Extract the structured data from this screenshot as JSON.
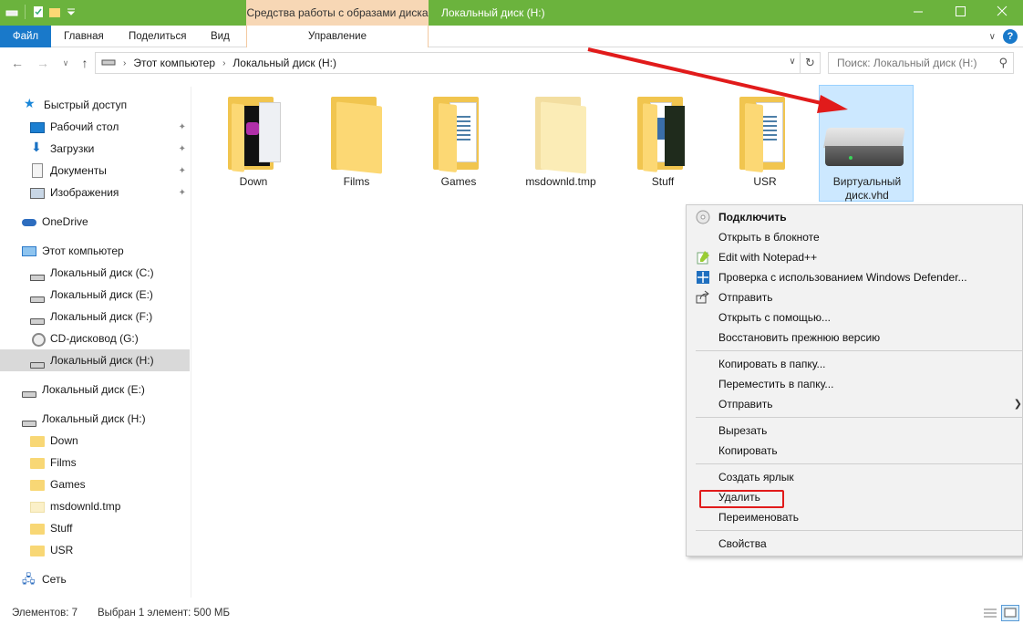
{
  "window": {
    "title": "Локальный диск (H:)",
    "context_tab_title": "Средства работы с образами диска",
    "minimize_icon": "minimize-icon",
    "maximize_icon": "maximize-icon",
    "close_icon": "close-icon"
  },
  "ribbon": {
    "tabs": {
      "file": "Файл",
      "home": "Главная",
      "share": "Поделиться",
      "view": "Вид",
      "manage": "Управление"
    }
  },
  "nav": {
    "breadcrumb": [
      "Этот компьютер",
      "Локальный диск (H:)"
    ],
    "search_placeholder": "Поиск: Локальный диск (H:)"
  },
  "sidebar": {
    "items": [
      {
        "label": "Быстрый доступ",
        "icon": "star-icon"
      },
      {
        "label": "Рабочий стол",
        "icon": "desktop-icon"
      },
      {
        "label": "Загрузки",
        "icon": "download-icon"
      },
      {
        "label": "Документы",
        "icon": "documents-icon"
      },
      {
        "label": "Изображения",
        "icon": "pictures-icon"
      },
      {
        "label": "OneDrive",
        "icon": "cloud-icon"
      },
      {
        "label": "Этот компьютер",
        "icon": "computer-icon"
      },
      {
        "label": "Локальный диск (C:)",
        "icon": "drive-icon"
      },
      {
        "label": "Локальный диск (E:)",
        "icon": "drive-icon"
      },
      {
        "label": "Локальный диск (F:)",
        "icon": "drive-icon"
      },
      {
        "label": "CD-дисковод (G:)",
        "icon": "cd-icon"
      },
      {
        "label": "Локальный диск (H:)",
        "icon": "drive-icon"
      },
      {
        "label": "Локальный диск (E:)",
        "icon": "drive-icon"
      },
      {
        "label": "Локальный диск (H:)",
        "icon": "drive-icon"
      },
      {
        "label": "Down",
        "icon": "folder-icon"
      },
      {
        "label": "Films",
        "icon": "folder-icon"
      },
      {
        "label": "Games",
        "icon": "folder-icon"
      },
      {
        "label": "msdownld.tmp",
        "icon": "folder-icon"
      },
      {
        "label": "Stuff",
        "icon": "folder-icon"
      },
      {
        "label": "USR",
        "icon": "folder-icon"
      },
      {
        "label": "Сеть",
        "icon": "network-icon"
      }
    ]
  },
  "files": [
    {
      "name": "Down",
      "type": "folder"
    },
    {
      "name": "Films",
      "type": "folder"
    },
    {
      "name": "Games",
      "type": "folder"
    },
    {
      "name": "msdownld.tmp",
      "type": "folder"
    },
    {
      "name": "Stuff",
      "type": "folder"
    },
    {
      "name": "USR",
      "type": "folder"
    },
    {
      "name": "Виртуальный диск.vhd",
      "type": "vhd"
    }
  ],
  "context_menu": {
    "items": [
      "Подключить",
      "Открыть в блокноте",
      "Edit with Notepad++",
      "Проверка с использованием Windows Defender...",
      "Отправить",
      "Открыть с помощью...",
      "Восстановить прежнюю версию",
      "Копировать в папку...",
      "Переместить в папку...",
      "Отправить",
      "Вырезать",
      "Копировать",
      "Создать ярлык",
      "Удалить",
      "Переименовать",
      "Свойства"
    ]
  },
  "status": {
    "items_count": "Элементов: 7",
    "selection": "Выбран 1 элемент: 500 МБ"
  },
  "colors": {
    "titlebar": "#6bb33d",
    "file_tab": "#1979ca",
    "context_tab": "#f7d7b5",
    "selection": "#cce8ff",
    "annotation_red": "#e11b1b"
  }
}
